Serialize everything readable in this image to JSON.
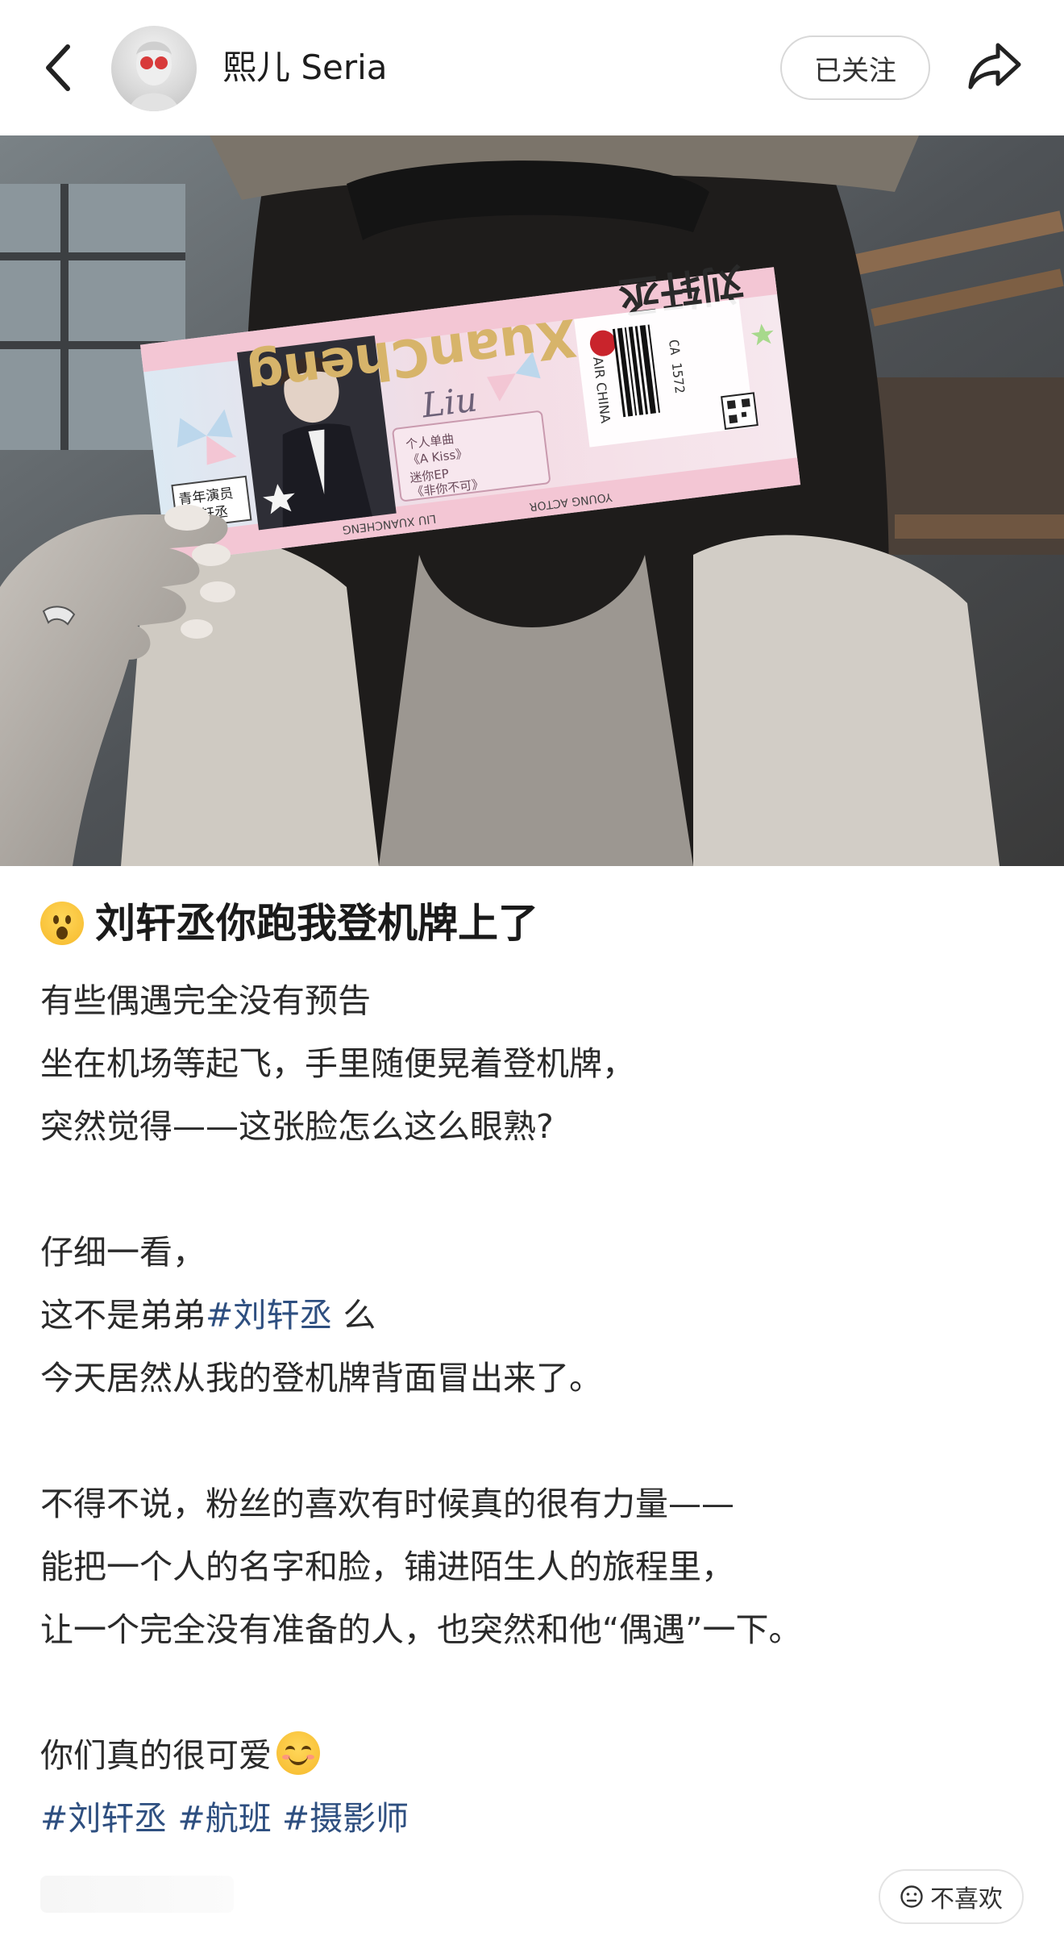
{
  "header": {
    "username": "熙儿 Seria",
    "follow_label": "已关注"
  },
  "icons": {
    "back": "chevron-left-icon",
    "share": "share-arrow-icon",
    "dislike": "neutral-face-icon"
  },
  "post": {
    "title": "刘轩丞你跑我登机牌上了",
    "title_emoji": "astonished-face",
    "lines": {
      "l1": "有些偶遇完全没有预告",
      "l2": "坐在机场等起飞，手里随便晃着登机牌，",
      "l3": "突然觉得——这张脸怎么这么眼熟?",
      "l4": "仔细一看，",
      "l5a": "这不是弟弟",
      "l5tag": "#刘轩丞",
      "l5b": " 么",
      "l6": "今天居然从我的登机牌背面冒出来了。",
      "l7": "不得不说，粉丝的喜欢有时候真的很有力量——",
      "l8": "能把一个人的名字和脸，铺进陌生人的旅程里，",
      "l9": "让一个完全没有准备的人，也突然和他“偶遇”一下。",
      "l10": "你们真的很可爱"
    },
    "closing_emoji": "smiling-face",
    "hashtags": [
      "#刘轩丞",
      "#航班",
      "#摄影师"
    ]
  },
  "ticket": {
    "wordmark": "XuanCheng",
    "name": "刘轩丞",
    "role": "青年演员",
    "script": "Liu",
    "airline": "AIR CHINA",
    "flight": "CA 1572",
    "english": "LIU XUANCHENG",
    "young_actor": "YOUNG ACTOR",
    "songs": [
      "个人单曲",
      "《A Kiss》",
      "迷你EP",
      "《非你不可》"
    ]
  },
  "footer": {
    "dislike_label": "不喜欢"
  },
  "colors": {
    "hashtag": "#2e4f80",
    "ticket_pink": "#f3c6d4",
    "ticket_blue": "#bcd7ec",
    "ticket_gold": "#d7b46a"
  }
}
